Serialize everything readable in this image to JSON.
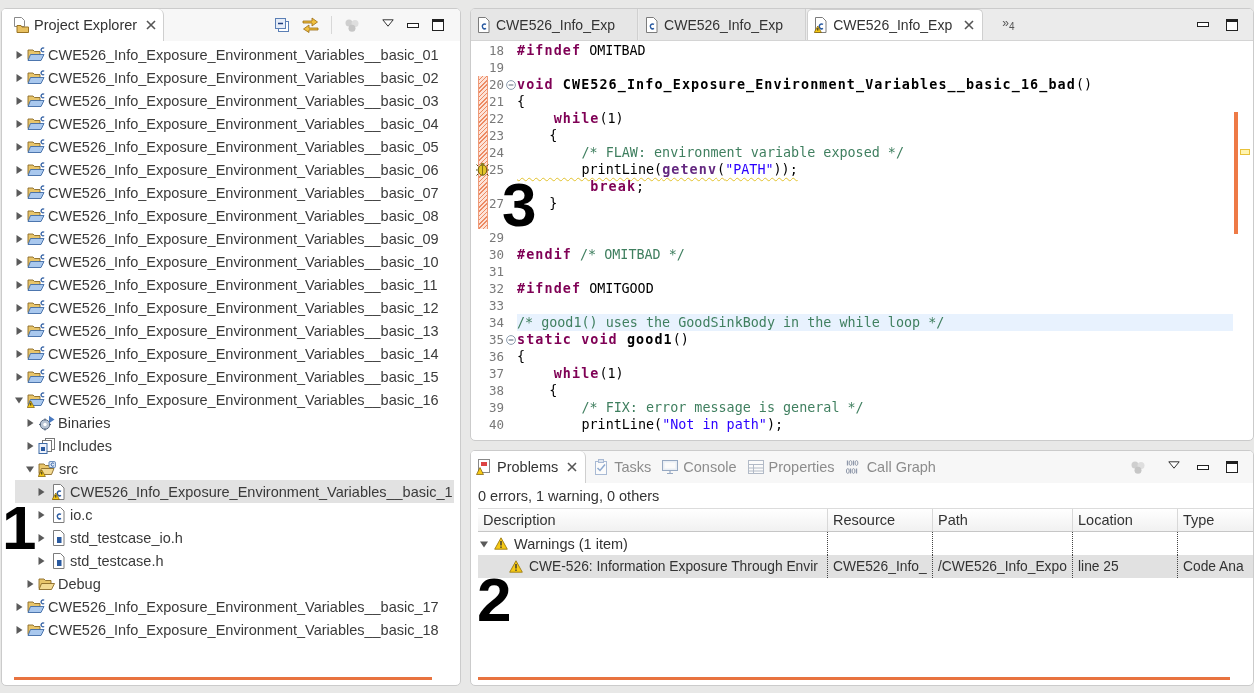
{
  "explorer": {
    "title": "Project Explorer",
    "annotation": "1",
    "tree": [
      {
        "label": "CWE526_Info_Exposure_Environment_Variables__basic_01",
        "kind": "project",
        "expanded": false,
        "selected": false,
        "warning": false
      },
      {
        "label": "CWE526_Info_Exposure_Environment_Variables__basic_02",
        "kind": "project",
        "expanded": false,
        "selected": false,
        "warning": false
      },
      {
        "label": "CWE526_Info_Exposure_Environment_Variables__basic_03",
        "kind": "project",
        "expanded": false,
        "selected": false,
        "warning": false
      },
      {
        "label": "CWE526_Info_Exposure_Environment_Variables__basic_04",
        "kind": "project",
        "expanded": false,
        "selected": false,
        "warning": false
      },
      {
        "label": "CWE526_Info_Exposure_Environment_Variables__basic_05",
        "kind": "project",
        "expanded": false,
        "selected": false,
        "warning": false
      },
      {
        "label": "CWE526_Info_Exposure_Environment_Variables__basic_06",
        "kind": "project",
        "expanded": false,
        "selected": false,
        "warning": false
      },
      {
        "label": "CWE526_Info_Exposure_Environment_Variables__basic_07",
        "kind": "project",
        "expanded": false,
        "selected": false,
        "warning": false
      },
      {
        "label": "CWE526_Info_Exposure_Environment_Variables__basic_08",
        "kind": "project",
        "expanded": false,
        "selected": false,
        "warning": false
      },
      {
        "label": "CWE526_Info_Exposure_Environment_Variables__basic_09",
        "kind": "project",
        "expanded": false,
        "selected": false,
        "warning": false
      },
      {
        "label": "CWE526_Info_Exposure_Environment_Variables__basic_10",
        "kind": "project",
        "expanded": false,
        "selected": false,
        "warning": false
      },
      {
        "label": "CWE526_Info_Exposure_Environment_Variables__basic_11",
        "kind": "project",
        "expanded": false,
        "selected": false,
        "warning": false
      },
      {
        "label": "CWE526_Info_Exposure_Environment_Variables__basic_12",
        "kind": "project",
        "expanded": false,
        "selected": false,
        "warning": false
      },
      {
        "label": "CWE526_Info_Exposure_Environment_Variables__basic_13",
        "kind": "project",
        "expanded": false,
        "selected": false,
        "warning": false
      },
      {
        "label": "CWE526_Info_Exposure_Environment_Variables__basic_14",
        "kind": "project",
        "expanded": false,
        "selected": false,
        "warning": false
      },
      {
        "label": "CWE526_Info_Exposure_Environment_Variables__basic_15",
        "kind": "project",
        "expanded": false,
        "selected": false,
        "warning": false
      },
      {
        "label": "CWE526_Info_Exposure_Environment_Variables__basic_16",
        "kind": "project",
        "expanded": true,
        "selected": false,
        "warning": true,
        "children": [
          {
            "label": "Binaries",
            "kind": "binaries",
            "expanded": false,
            "selected": false,
            "warning": false
          },
          {
            "label": "Includes",
            "kind": "includes",
            "expanded": false,
            "selected": false,
            "warning": false
          },
          {
            "label": "src",
            "kind": "source-folder",
            "expanded": true,
            "selected": false,
            "warning": true,
            "children": [
              {
                "label": "CWE526_Info_Exposure_Environment_Variables__basic_1",
                "kind": "c-file",
                "expanded": false,
                "selected": true,
                "warning": true
              },
              {
                "label": "io.c",
                "kind": "c-file",
                "expanded": false,
                "selected": false,
                "warning": false
              },
              {
                "label": "std_testcase_io.h",
                "kind": "h-file",
                "expanded": false,
                "selected": false,
                "warning": false
              },
              {
                "label": "std_testcase.h",
                "kind": "h-file",
                "expanded": false,
                "selected": false,
                "warning": false
              }
            ]
          },
          {
            "label": "Debug",
            "kind": "folder",
            "expanded": false,
            "selected": false,
            "warning": false
          }
        ]
      },
      {
        "label": "CWE526_Info_Exposure_Environment_Variables__basic_17",
        "kind": "project",
        "expanded": false,
        "selected": false,
        "warning": false
      },
      {
        "label": "CWE526_Info_Exposure_Environment_Variables__basic_18",
        "kind": "project",
        "expanded": false,
        "selected": false,
        "warning": false
      }
    ]
  },
  "editor": {
    "tabs": [
      {
        "label": "CWE526_Info_Exp",
        "kind": "c-file",
        "warning": false,
        "selected": false
      },
      {
        "label": "CWE526_Info_Exp",
        "kind": "c-file",
        "warning": false,
        "selected": false
      },
      {
        "label": "CWE526_Info_Exp",
        "kind": "c-file",
        "warning": true,
        "selected": true
      }
    ],
    "hidden_tabs": "»$_{4}$",
    "annotation": "3",
    "lines": [
      {
        "number": "18",
        "fold": false,
        "changed": false,
        "warning": false,
        "highlighted": false,
        "tokens": [
          {
            "kind": "keyword",
            "text": "#ifndef"
          },
          {
            "kind": "plain",
            "text": " OMITBAD"
          }
        ]
      },
      {
        "number": "19",
        "fold": false,
        "changed": false,
        "warning": false,
        "highlighted": false
      },
      {
        "number": "20",
        "fold": true,
        "changed": true,
        "warning": false,
        "highlighted": false,
        "tokens": [
          {
            "kind": "keyword",
            "text": "void "
          },
          {
            "kind": "function",
            "text": "CWE526_Info_Exposure_Environment_Variables__basic_16_bad"
          },
          {
            "kind": "plain",
            "text": "()"
          }
        ]
      },
      {
        "number": "21",
        "fold": false,
        "changed": true,
        "warning": false,
        "highlighted": false,
        "tokens": [
          {
            "kind": "plain",
            "text": "{"
          }
        ]
      },
      {
        "number": "22",
        "fold": false,
        "changed": true,
        "warning": false,
        "highlighted": false,
        "tokens": [
          {
            "kind": "keyword",
            "text": "    while"
          },
          {
            "kind": "plain",
            "text": "(1)"
          }
        ]
      },
      {
        "number": "23",
        "fold": false,
        "changed": true,
        "warning": false,
        "highlighted": false,
        "tokens": [
          {
            "kind": "plain",
            "text": "    {"
          }
        ]
      },
      {
        "number": "24",
        "fold": false,
        "changed": true,
        "warning": false,
        "highlighted": false,
        "tokens": [
          {
            "kind": "comment",
            "text": "        /* FLAW: environment variable exposed */"
          }
        ]
      },
      {
        "number": "25",
        "fold": false,
        "changed": true,
        "warning": true,
        "highlighted": false,
        "tokens": [
          {
            "kind": "plain",
            "text": "        printLine("
          },
          {
            "kind": "macro",
            "text": "getenv"
          },
          {
            "kind": "plain",
            "text": "("
          },
          {
            "kind": "string",
            "text": "\"PATH\""
          },
          {
            "kind": "plain",
            "text": "));"
          }
        ]
      },
      {
        "fold": false,
        "changed": true,
        "warning": false,
        "highlighted": false,
        "tokens": [
          {
            "kind": "keyword",
            "text": "        break"
          },
          {
            "kind": "plain",
            "text": ";"
          }
        ]
      },
      {
        "number": "27",
        "fold": false,
        "changed": true,
        "warning": false,
        "highlighted": false,
        "tokens": [
          {
            "kind": "plain",
            "text": "    }"
          }
        ]
      },
      {
        "fold": false,
        "changed": true,
        "warning": false,
        "highlighted": false
      },
      {
        "number": "29",
        "fold": false,
        "changed": false,
        "warning": false,
        "highlighted": false
      },
      {
        "number": "30",
        "fold": false,
        "changed": false,
        "warning": false,
        "highlighted": false,
        "tokens": [
          {
            "kind": "keyword",
            "text": "#endif"
          },
          {
            "kind": "comment",
            "text": " /* OMITBAD */"
          }
        ]
      },
      {
        "number": "31",
        "fold": false,
        "changed": false,
        "warning": false,
        "highlighted": false
      },
      {
        "number": "32",
        "fold": false,
        "changed": false,
        "warning": false,
        "highlighted": false,
        "tokens": [
          {
            "kind": "keyword",
            "text": "#ifndef"
          },
          {
            "kind": "plain",
            "text": " OMITGOOD"
          }
        ]
      },
      {
        "number": "33",
        "fold": false,
        "changed": false,
        "warning": false,
        "highlighted": false
      },
      {
        "number": "34",
        "fold": false,
        "changed": false,
        "warning": false,
        "highlighted": true,
        "tokens": [
          {
            "kind": "comment",
            "text": "/* good1() uses the GoodSinkBody in the while loop */"
          }
        ]
      },
      {
        "number": "35",
        "fold": true,
        "changed": false,
        "warning": false,
        "highlighted": false,
        "tokens": [
          {
            "kind": "keyword",
            "text": "static void "
          },
          {
            "kind": "function",
            "text": "good1"
          },
          {
            "kind": "plain",
            "text": "()"
          }
        ]
      },
      {
        "number": "36",
        "fold": false,
        "changed": false,
        "warning": false,
        "highlighted": false,
        "tokens": [
          {
            "kind": "plain",
            "text": "{"
          }
        ]
      },
      {
        "number": "37",
        "fold": false,
        "changed": false,
        "warning": false,
        "highlighted": false,
        "tokens": [
          {
            "kind": "keyword",
            "text": "    while"
          },
          {
            "kind": "plain",
            "text": "(1)"
          }
        ]
      },
      {
        "number": "38",
        "fold": false,
        "changed": false,
        "warning": false,
        "highlighted": false,
        "tokens": [
          {
            "kind": "plain",
            "text": "    {"
          }
        ]
      },
      {
        "number": "39",
        "fold": false,
        "changed": false,
        "warning": false,
        "highlighted": false,
        "tokens": [
          {
            "kind": "comment",
            "text": "        /* FIX: error message is general */"
          }
        ]
      },
      {
        "number": "40",
        "fold": false,
        "changed": false,
        "warning": false,
        "highlighted": false,
        "tokens": [
          {
            "kind": "plain",
            "text": "        printLine("
          },
          {
            "kind": "string",
            "text": "\"Not in path\""
          },
          {
            "kind": "plain",
            "text": ");"
          }
        ]
      }
    ]
  },
  "problems": {
    "tabs": [
      {
        "label": "Problems",
        "kind": "problems",
        "selected": true
      },
      {
        "label": "Tasks",
        "kind": "tasks",
        "selected": false
      },
      {
        "label": "Console",
        "kind": "console",
        "selected": false
      },
      {
        "label": "Properties",
        "kind": "properties",
        "selected": false
      },
      {
        "label": "Call Graph",
        "kind": "call-graph",
        "selected": false
      }
    ],
    "summary": "0 errors, 1 warning, 0 others",
    "columns": [
      "Description",
      "Resource",
      "Path",
      "Location",
      "Type"
    ],
    "groups": [
      {
        "label": "Warnings (1 item)",
        "expanded": true,
        "rows": [
          {
            "selected": true,
            "cells": [
              "CWE-526: Information Exposure Through Envir",
              "CWE526_Info_",
              "/CWE526_Info_Expo",
              "line 25",
              "Code Ana"
            ]
          }
        ]
      }
    ],
    "annotation": "2"
  }
}
